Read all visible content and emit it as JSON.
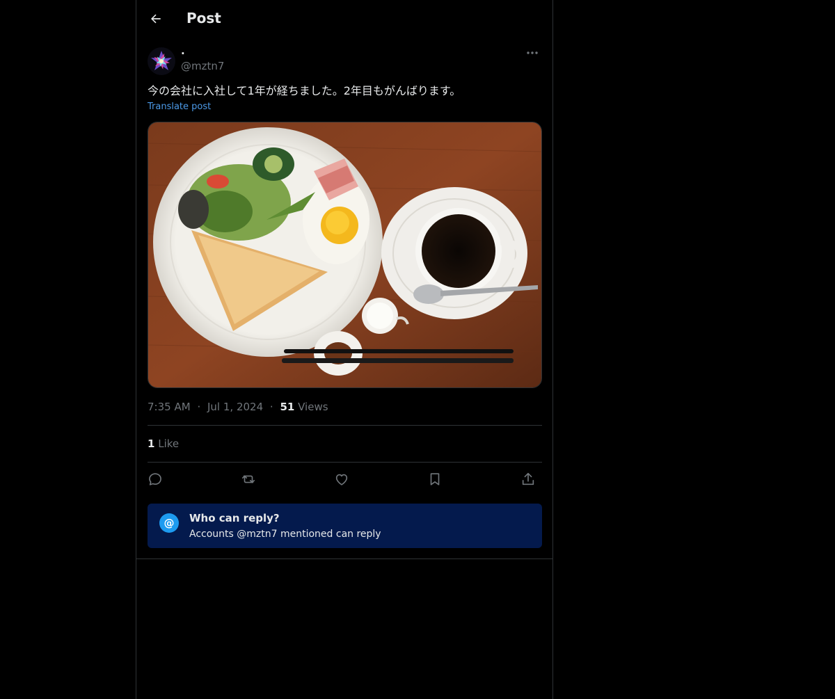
{
  "header": {
    "title": "Post",
    "back_icon": "arrow-left-icon"
  },
  "author": {
    "display_name": "·",
    "handle": "@mztn7",
    "avatar": "flower-avatar",
    "more_icon": "more-horizontal-icon"
  },
  "post": {
    "text": "今の会社に入社して1年が経ちました。2年目もがんばります。",
    "translate_label": "Translate post",
    "media": "photo-breakfast-plate-toast-egg-salad-coffee"
  },
  "meta": {
    "time": "7:35 AM",
    "separator": "·",
    "date": "Jul 1, 2024",
    "views_count": "51",
    "views_label": "Views"
  },
  "likes": {
    "count": "1",
    "label": "Like"
  },
  "actions": [
    {
      "name": "reply",
      "icon": "reply-icon"
    },
    {
      "name": "repost",
      "icon": "repost-icon"
    },
    {
      "name": "like",
      "icon": "heart-icon"
    },
    {
      "name": "bookmark",
      "icon": "bookmark-icon"
    },
    {
      "name": "share",
      "icon": "share-icon"
    }
  ],
  "reply_notice": {
    "symbol": "@",
    "title": "Who can reply?",
    "subtitle": "Accounts @mztn7 mentioned can reply"
  },
  "colors": {
    "background": "#000000",
    "text": "#e7e9ea",
    "muted": "#71767b",
    "link": "#4c9ae8",
    "accent": "#1d9bf0",
    "notice_bg": "#041a4d",
    "border": "#2f3336"
  }
}
